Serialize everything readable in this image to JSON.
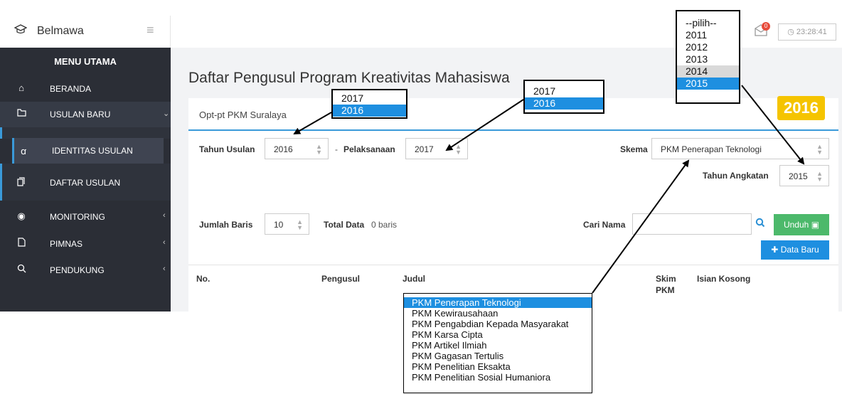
{
  "brand": {
    "name": "Belmawa",
    "cap_icon": "graduation-cap-icon",
    "menu_icon": "hamburger-icon"
  },
  "topbar": {
    "clock": "23:28:41",
    "notif_count": "0"
  },
  "sidebar": {
    "heading": "MENU UTAMA",
    "items": [
      {
        "label": "BERANDA",
        "icon": "home-icon"
      },
      {
        "label": "USULAN BARU",
        "icon": "folder-icon"
      },
      {
        "label": "IDENTITAS USULAN",
        "icon": "users-icon"
      },
      {
        "label": "DAFTAR USULAN",
        "icon": "documents-icon"
      },
      {
        "label": "MONITORING",
        "icon": "eye-icon"
      },
      {
        "label": "PIMNAS",
        "icon": "file-icon"
      },
      {
        "label": "PENDUKUNG",
        "icon": "search-icon"
      }
    ]
  },
  "main": {
    "title": "Daftar Pengusul Program Kreativitas Mahasiswa",
    "tab": "Opt-pt PKM Suralaya",
    "filters": {
      "tahun_usulan_label": "Tahun Usulan",
      "tahun_usulan_value": "2016",
      "dash": "-",
      "pelaksanaan_label": "Pelaksanaan",
      "pelaksanaan_value": "2017",
      "skema_label": "Skema",
      "skema_value": "PKM Penerapan Teknologi",
      "tahun_angkatan_label": "Tahun Angkatan",
      "tahun_angkatan_value": "2015",
      "jumlah_baris_label": "Jumlah Baris",
      "jumlah_baris_value": "10",
      "total_data_label": "Total Data",
      "total_data_value": "0 baris",
      "cari_nama_label": "Cari Nama",
      "cari_nama_value": ""
    },
    "buttons": {
      "unduh": "Unduh",
      "data_baru": "Data Baru"
    },
    "table_headers": {
      "no": "No.",
      "pengusul": "Pengusul",
      "judul": "Judul",
      "skim": "Skim",
      "skim2": "PKM",
      "isian": "Isian Kosong"
    }
  },
  "overlays": {
    "year_badge": "2016",
    "dd_tahun_usulan": [
      "2017",
      "2016"
    ],
    "dd_pelaksanaan": [
      "2017",
      "2016"
    ],
    "dd_angkatan": [
      "--pilih--",
      "2011",
      "2012",
      "2013",
      "2014",
      "2015"
    ],
    "dd_skema": [
      "PKM Penerapan Teknologi",
      "PKM Kewirausahaan",
      "PKM Pengabdian Kepada Masyarakat",
      "PKM Karsa Cipta",
      "PKM Artikel Ilmiah",
      "PKM Gagasan Tertulis",
      "PKM Penelitian Eksakta",
      "PKM Penelitian Sosial Humaniora"
    ]
  },
  "colors": {
    "sidebar": "#2b2e36",
    "accent": "#3a9ad9",
    "green": "#4cb96b",
    "highlight": "#1e8fe0",
    "badge": "#f5c400"
  }
}
